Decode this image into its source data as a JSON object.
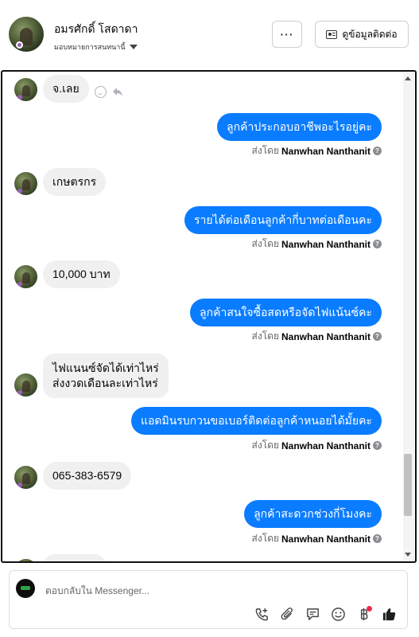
{
  "header": {
    "name": "อมรศักดิ์ โสดาดา",
    "assign_label": "มอบหมายการสนทนานี้",
    "more_label": "···",
    "contact_label": "ดูข้อมูลติดต่อ"
  },
  "sender_name": "Nanwhan Nanthanit",
  "sent_by_prefix": "ส่งโดย",
  "messages": [
    {
      "dir": "in",
      "text": "จ.เลย"
    },
    {
      "dir": "out",
      "text": "ลูกค้าประกอบอาชีพอะไรอยู่คะ"
    },
    {
      "dir": "in",
      "text": "เกษตรกร"
    },
    {
      "dir": "out",
      "text": "รายได้ต่อเดือนลูกค้ากี่บาทต่อเดือนคะ"
    },
    {
      "dir": "in",
      "text": "10,000 บาท"
    },
    {
      "dir": "out",
      "text": "ลูกค้าสนใจซื้อสดหรือจัดไฟแน้นซ์คะ"
    },
    {
      "dir": "in",
      "lines": [
        "ไฟแนนซ์จัดได้เท่าไหร่",
        "ส่งงวดเดือนละเท่าไหร่"
      ]
    },
    {
      "dir": "out",
      "text": "แอดมินรบกวนขอเบอร์ติดต่อลูกค้าหนอยได้มั้ยคะ"
    },
    {
      "dir": "in",
      "text": "065-383-6579"
    },
    {
      "dir": "out",
      "text": "ลูกค้าสะดวกช่วงกี่โมงคะ"
    }
  ],
  "composer": {
    "placeholder": "ตอบกลับใน Messenger..."
  },
  "icons": [
    "more-icon",
    "contact-card-icon",
    "smile-icon",
    "reply-icon",
    "call-add-icon",
    "attach-icon",
    "saved-reply-icon",
    "emoji-icon",
    "payment-icon",
    "like-icon"
  ],
  "colors": {
    "outgoing_bubble": "#0a7cff",
    "incoming_bubble": "#f0f0f0",
    "like": "#1c1e21",
    "notification": "#f02849"
  }
}
